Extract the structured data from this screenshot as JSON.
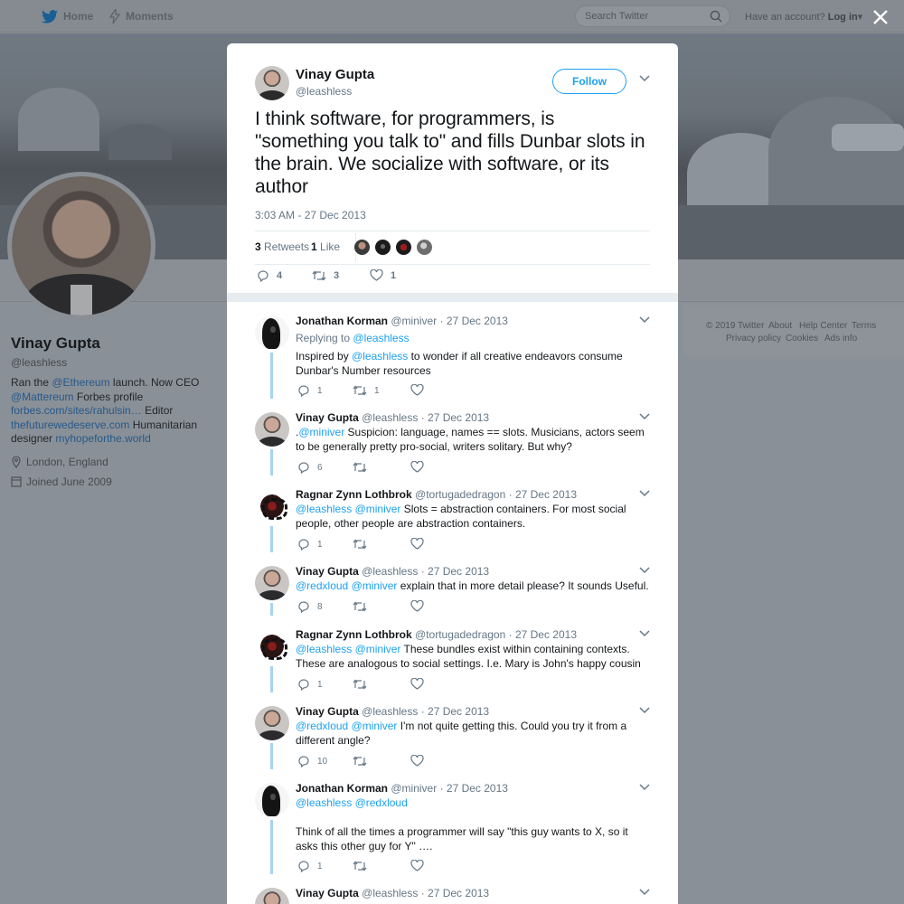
{
  "nav": {
    "home_label": "Home",
    "moments_label": "Moments",
    "search_placeholder": "Search Twitter",
    "have_account": "Have an account?",
    "login_label": "Log in"
  },
  "profile": {
    "name": "Vinay Gupta",
    "handle": "@leashless",
    "bio": {
      "t1": "Ran the ",
      "l1": "@Ethereum",
      "t2": " launch. Now CEO ",
      "l2": "@Mattereum",
      "t3": " Forbes profile ",
      "l3": "forbes.com/sites/rahulsin…",
      "t4": " Editor ",
      "l4": "thefuturewedeserve.com",
      "t5": " Humanitarian designer ",
      "l5": "myhopeforthe.world"
    },
    "location": "London, England",
    "joined": "Joined June 2009"
  },
  "footer": {
    "copyright": "© 2019 Twitter",
    "about": "About",
    "help": "Help Center",
    "terms": "Terms",
    "privacy": "Privacy policy",
    "cookies": "Cookies",
    "ads": "Ads info"
  },
  "tweet": {
    "author_name": "Vinay Gupta",
    "author_handle": "@leashless",
    "follow_label": "Follow",
    "text": "I think software, for programmers, is \"something you talk to\" and fills Dunbar slots in the brain. We socialize with software, or its author",
    "time": "3:03 AM - 27 Dec 2013",
    "retweets_count": "3",
    "retweets_label": "Retweets",
    "likes_count": "1",
    "likes_label": "Like",
    "reply_count": "4",
    "retweet_count": "3",
    "like_count": "1"
  },
  "replies": [
    {
      "name": "Jonathan Korman",
      "handle": "@miniver",
      "date": "· 27 Dec 2013",
      "replying_prefix": "Replying to",
      "replying_to": "@leashless",
      "body": {
        "t1": "Inspired by ",
        "l1": "@leashless",
        "t2": " to wonder if all creative endeavors consume Dunbar's Number resources"
      },
      "reply_count": "1",
      "retweet_count": "1"
    },
    {
      "name": "Vinay Gupta",
      "handle": "@leashless",
      "date": "· 27 Dec 2013",
      "body": {
        "t0": ".",
        "l1": "@miniver",
        "t2": " Suspicion: language, names == slots. Musicians, actors seem to be generally pretty pro-social, writers solitary. But why?"
      },
      "reply_count": "6"
    },
    {
      "name": "Ragnar Zynn Lothbrok",
      "handle": "@tortugadedragon",
      "date": "· 27 Dec 2013",
      "body": {
        "l1": "@leashless",
        "l2": "@miniver",
        "t2": " Slots = abstraction containers. For most social people, other people are abstraction containers."
      },
      "reply_count": "1"
    },
    {
      "name": "Vinay Gupta",
      "handle": "@leashless",
      "date": "· 27 Dec 2013",
      "body": {
        "l1": "@redxloud",
        "l2": "@miniver",
        "t2": " explain that in more detail please? It sounds Useful."
      },
      "reply_count": "8"
    },
    {
      "name": "Ragnar Zynn Lothbrok",
      "handle": "@tortugadedragon",
      "date": "· 27 Dec 2013",
      "body": {
        "l1": "@leashless",
        "l2": "@miniver",
        "t2": " These bundles exist within containing contexts. These are analogous to social settings. I.e. Mary is John's happy cousin"
      },
      "reply_count": "1"
    },
    {
      "name": "Vinay Gupta",
      "handle": "@leashless",
      "date": "· 27 Dec 2013",
      "body": {
        "l1": "@redxloud",
        "l2": "@miniver",
        "t2": " I'm not quite getting this. Could you try it from a different angle?"
      },
      "reply_count": "10"
    },
    {
      "name": "Jonathan Korman",
      "handle": "@miniver",
      "date": "· 27 Dec 2013",
      "body": {
        "l1": "@leashless",
        "l2": "@redxloud",
        "t2": "Think of all the times a programmer will say \"this guy wants to X, so it asks this other guy for Y\" …."
      },
      "reply_count": "1"
    },
    {
      "name": "Vinay Gupta",
      "handle": "@leashless",
      "date": "· 27 Dec 2013"
    }
  ],
  "colors": {
    "accent": "#1da1f2",
    "thread_line": "#a5d4f3",
    "overlay": "#8a9097"
  },
  "icons": [
    "twitter-bird-icon",
    "lightning-icon",
    "search-icon",
    "close-icon",
    "chevron-down-icon",
    "reply-icon",
    "retweet-icon",
    "heart-icon",
    "location-icon",
    "calendar-icon"
  ]
}
